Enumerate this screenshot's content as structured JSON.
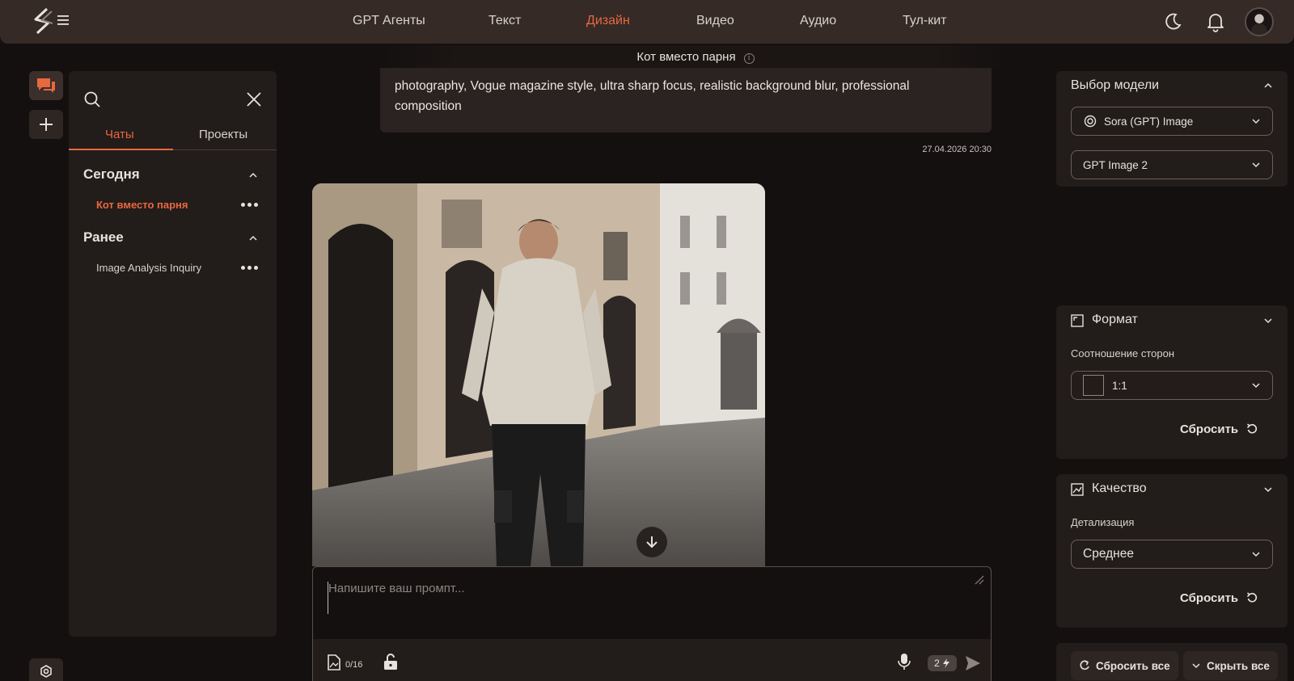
{
  "nav": {
    "items": [
      "GPT Агенты",
      "Текст",
      "Дизайн",
      "Видео",
      "Аудио",
      "Тул-кит"
    ],
    "active_index": 2
  },
  "chat_title": "Кот вместо парня",
  "sidebar": {
    "tabs": [
      "Чаты",
      "Проекты"
    ],
    "active_tab": 0,
    "sections": [
      {
        "title": "Сегодня",
        "items": [
          {
            "label": "Кот вместо парня",
            "active": true
          }
        ]
      },
      {
        "title": "Ранее",
        "items": [
          {
            "label": "Image Analysis Inquiry",
            "active": false
          }
        ]
      }
    ]
  },
  "message": {
    "prompt_line1": "photography, Vogue magazine style, ultra sharp focus, realistic background blur, professional",
    "prompt_line2": "composition",
    "timestamp": "27.04.2026 20:30"
  },
  "input": {
    "placeholder": "Напишите ваш промпт...",
    "image_counter": "0/16",
    "cost_badge": "2"
  },
  "right": {
    "model": {
      "title": "Выбор модели",
      "provider": "Sora (GPT) Image",
      "version": "GPT Image 2"
    },
    "format": {
      "title": "Формат",
      "aspect_label": "Соотношение сторон",
      "aspect_value": "1:1",
      "reset": "Сбросить"
    },
    "quality": {
      "title": "Качество",
      "detail_label": "Детализация",
      "detail_value": "Среднее",
      "reset": "Сбросить"
    },
    "reset_all": "Сбросить все",
    "hide_all": "Скрыть все"
  },
  "colors": {
    "accent": "#e8683f",
    "topbar": "#352a26",
    "panel": "#221c1a",
    "background": "#141010"
  }
}
